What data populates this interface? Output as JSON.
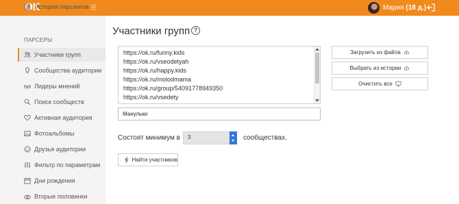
{
  "header": {
    "logo": "OK",
    "user_name": "Мария",
    "user_days": "(18 д.)"
  },
  "sidebar": {
    "top_item": "История парсингов",
    "section_title": "ПАРСЕРЫ",
    "items": [
      {
        "label": "Участники групп",
        "icon": "people-icon",
        "active": true
      },
      {
        "label": "Сообщества аудитории",
        "icon": "bulb-icon"
      },
      {
        "label": "Лидеры мнений",
        "icon": "glasses-icon"
      },
      {
        "label": "Поиск сообществ",
        "icon": "search-icon"
      },
      {
        "label": "Активная аудитория",
        "icon": "heart-icon"
      },
      {
        "label": "Фотоальбомы",
        "icon": "photo-icon"
      },
      {
        "label": "Друзья аудитории",
        "icon": "smile-icon"
      },
      {
        "label": "Фильтр по параметрам",
        "icon": "filter-icon"
      },
      {
        "label": "Дни рождения",
        "icon": "calendar-icon"
      },
      {
        "label": "Вторые половинки",
        "icon": "rings-icon"
      }
    ]
  },
  "main": {
    "title": "Участники групп",
    "urls": [
      "https://ok.ru/funny.kids",
      "https://ok.ru/vseodetyah",
      "https://ok.ru/happy.kids",
      "https://ok.ru/molodmama",
      "https://ok.ru/group/54091778949350",
      "https://ok.ru/vsedety"
    ],
    "keyword_value": "Манульки",
    "buttons": {
      "load_file": "Загрузить из файла",
      "choose_history": "Выбрать из истории",
      "clear_all": "Очистить все"
    },
    "min_label": "Состоят минимум в",
    "min_value": "3",
    "min_suffix": "сообществах.",
    "find_button": "Найти участников"
  },
  "colors": {
    "header": "#f08a1c",
    "sidebar_bg": "#f4f4f4",
    "spinner_accent": "#2f7ad6"
  }
}
